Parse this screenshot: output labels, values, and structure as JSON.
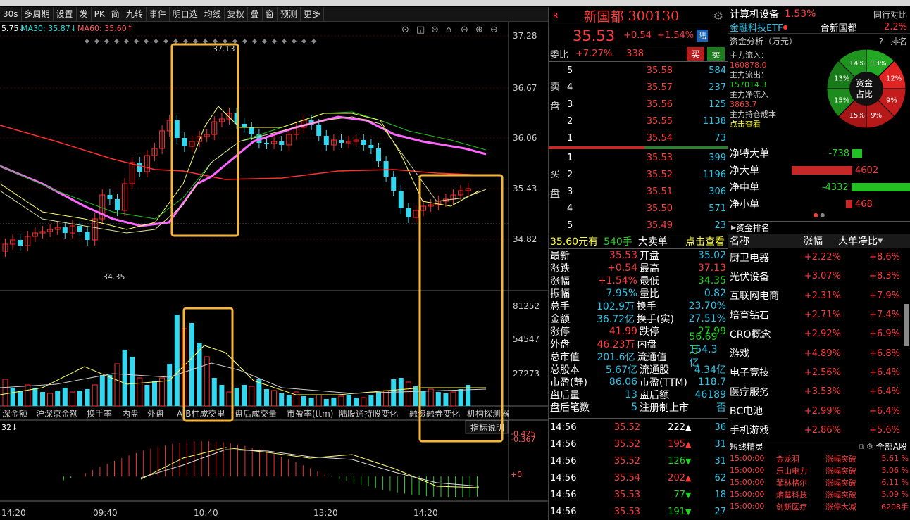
{
  "toolbar": {
    "items": [
      "30s",
      "多周期",
      "设置",
      "发",
      "PK",
      "简",
      "九转",
      "事件",
      "明自选",
      "均线",
      "复权",
      "叠",
      "窗",
      "预测",
      "更多"
    ]
  },
  "indicator": {
    "ma10": "5.75↓",
    "ma30": "MA30: 35.87↓",
    "ma60": "MA60: 35.60↑"
  },
  "price_axis": [
    "37.28",
    "36.67",
    "36.06",
    "35.43",
    "34.82"
  ],
  "vol_axis": [
    "81252",
    "54547",
    "27273"
  ],
  "macd_axis": [
    "-0.425",
    "-0.367",
    "+0"
  ],
  "time_axis": [
    "14:20",
    "09:40",
    "10:40",
    "13:20",
    "14:20"
  ],
  "chart_labels": {
    "high": "37.13",
    "low": "34.35",
    "bottom_left": "32↓",
    "help": "指标说明"
  },
  "tabs": [
    "深金额",
    "沪深京金额",
    "换手率",
    "内盘",
    "外盘",
    "A/B柱成交里",
    "盘后成交量",
    "市盈率(ttm)",
    "陆股通持股变化",
    "融资融券变化",
    "机构探测器"
  ],
  "stock": {
    "tag": "R",
    "name": "新国都",
    "code": "300130",
    "price": "35.53",
    "chg": "+0.54",
    "pct": "+1.54%",
    "badge": "陆",
    "weibi_label": "委比",
    "weibi": "+7.27%",
    "weicha": "338",
    "buy": "买",
    "sell": "卖"
  },
  "sell_label": [
    "卖",
    "盘"
  ],
  "buy_label": [
    "买",
    "盘"
  ],
  "asks": [
    {
      "n": "5",
      "p": "35.58",
      "v": "584"
    },
    {
      "n": "4",
      "p": "35.57",
      "v": "237"
    },
    {
      "n": "3",
      "p": "35.56",
      "v": "125"
    },
    {
      "n": "2",
      "p": "35.55",
      "v": "1138"
    },
    {
      "n": "1",
      "p": "35.54",
      "v": "73"
    }
  ],
  "bids": [
    {
      "n": "1",
      "p": "35.53",
      "v": "399"
    },
    {
      "n": "2",
      "p": "35.52",
      "v": "1196"
    },
    {
      "n": "3",
      "p": "35.51",
      "v": "306"
    },
    {
      "n": "4",
      "p": "35.50",
      "v": "571"
    },
    {
      "n": "5",
      "p": "35.49",
      "v": "23"
    }
  ],
  "bigorder": {
    "a": "35.60元有",
    "b": "540手",
    "c": "大卖单",
    "d": "点击查看"
  },
  "stats": [
    [
      "最新",
      "35.53",
      "开盘",
      "35.02"
    ],
    [
      "涨跌",
      "+0.54",
      "最高",
      "37.13"
    ],
    [
      "涨幅",
      "+1.54%",
      "最低",
      "34.35"
    ],
    [
      "振幅",
      "7.95%",
      "量比",
      "0.82"
    ],
    [
      "总手",
      "102.9万",
      "换手",
      "23.70%"
    ],
    [
      "金额",
      "36.72亿",
      "换手(实)",
      "27.51%"
    ],
    [
      "涨停",
      "41.99",
      "跌停",
      "27.99"
    ],
    [
      "外盘",
      "46.23万",
      "内盘",
      "56.69万"
    ],
    [
      "总市值",
      "201.6亿",
      "流通值",
      "154.3亿"
    ],
    [
      "总股本",
      "5.67亿",
      "流通股",
      "4.34亿"
    ],
    [
      "市盈(静)",
      "86.06",
      "市盈(TTM)",
      "118.7"
    ],
    [
      "盘后量",
      "13",
      "盘后额",
      "46189"
    ],
    [
      "盘后笔数",
      "5",
      "注册制上市",
      "否"
    ]
  ],
  "ticks": [
    [
      "14:56",
      "35.52",
      "222",
      "36"
    ],
    [
      "14:56",
      "35.52",
      "195",
      "31"
    ],
    [
      "14:56",
      "35.52",
      "126",
      "31"
    ],
    [
      "14:56",
      "35.54",
      "202",
      "62"
    ],
    [
      "14:56",
      "35.53",
      "77",
      "18"
    ],
    [
      "14:56",
      "35.53",
      "191",
      "27"
    ]
  ],
  "sector": {
    "name": "计算机设备",
    "pct": "1.53%",
    "peer": "同行对比",
    "etf": "金融科技ETF",
    "etfpct": "2.2%",
    "stock": "合新国都"
  },
  "fund": {
    "title": "资金分析（万元）",
    "rank": "排名",
    "q": "?",
    "inflow_l": "主力流入：",
    "inflow": "160878.0",
    "outflow_l": "主力流出：",
    "outflow": "157014.3",
    "net_l": "主力净流入",
    "net": "3863.7",
    "cost_l": "主力持仓成本",
    "cost": "点击查看",
    "center1": "资金",
    "center2": "占比",
    "pie": [
      "13%",
      "12%",
      "9%",
      "9%",
      "15%",
      "15%",
      "13%",
      "14%"
    ]
  },
  "netrows": [
    {
      "l": "净特大单",
      "v": "-738"
    },
    {
      "l": "净大单",
      "v": "4602"
    },
    {
      "l": "净中单",
      "v": "-4332"
    },
    {
      "l": "净小单",
      "v": "468"
    }
  ],
  "rank": {
    "title": "资金排名",
    "h1": "名称",
    "h2": "涨幅",
    "h3": "大单净比"
  },
  "ranklist": [
    [
      "厨卫电器",
      "+2.22%",
      "+8.6%"
    ],
    [
      "光伏设备",
      "+3.07%",
      "+8.3%"
    ],
    [
      "互联网电商",
      "+2.31%",
      "+7.9%"
    ],
    [
      "培育钻石",
      "+2.71%",
      "+7.4%"
    ],
    [
      "CRO概念",
      "+2.92%",
      "+6.9%"
    ],
    [
      "游戏",
      "+4.89%",
      "+6.8%"
    ],
    [
      "电子竞技",
      "+2.56%",
      "+6.4%"
    ],
    [
      "医疗服务",
      "+3.53%",
      "+6.4%"
    ],
    [
      "BC电池",
      "+2.99%",
      "+6.4%"
    ],
    [
      "手机游戏",
      "+2.86%",
      "+5.6%"
    ]
  ],
  "short": {
    "title": "短线精灵",
    "all": "全部A股",
    "rows": [
      [
        "15:00:00",
        "金龙羽",
        "涨幅突破",
        "5.61 %"
      ],
      [
        "15:00:00",
        "乐山电力",
        "涨幅突破",
        "5.06 %"
      ],
      [
        "15:00:00",
        "菲林格尔",
        "涨幅突破",
        "6.11 %"
      ],
      [
        "15:00:00",
        "熵基科技",
        "涨幅突破",
        "5.09 %"
      ],
      [
        "15:00:00",
        "创新医疗",
        "涨停大减",
        "6208手"
      ]
    ]
  }
}
